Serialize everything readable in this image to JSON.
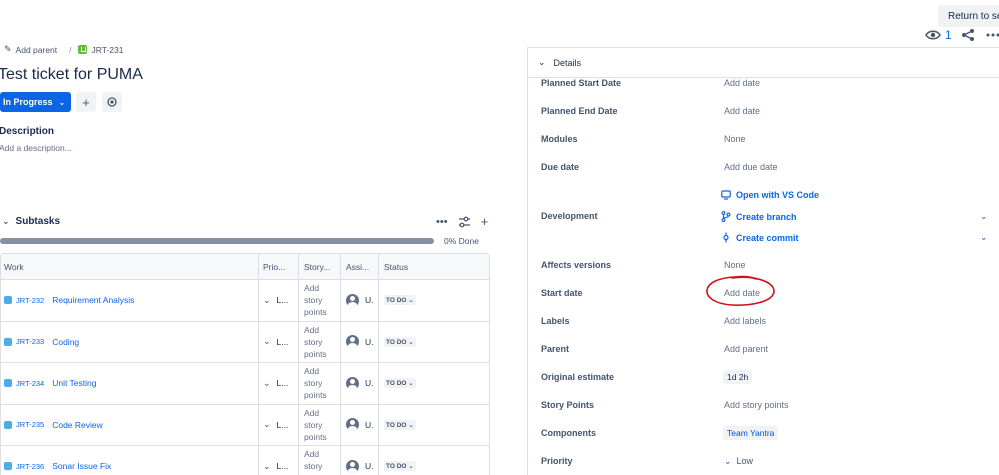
{
  "top": {
    "return_label": "Return to sea",
    "watch_count": "1"
  },
  "breadcrumb": {
    "add_parent": "Add parent",
    "separator": "/",
    "issue_key": "JRT-231"
  },
  "issue": {
    "title": "Test ticket for PUMA",
    "status": "In Progress",
    "description_heading": "Description",
    "description_placeholder": "Add a description..."
  },
  "subtasks": {
    "heading": "Subtasks",
    "progress_label": "0% Done",
    "progress_fraction": 0,
    "columns": [
      "Work",
      "Prio...",
      "Story...",
      "Assi...",
      "Status"
    ],
    "rows": [
      {
        "key": "JRT-232",
        "summary": "Requirement Analysis",
        "priority": "L...",
        "story_points": "Add story points",
        "assignee": "U.",
        "status": "TO DO"
      },
      {
        "key": "JRT-233",
        "summary": "Coding",
        "priority": "L...",
        "story_points": "Add story points",
        "assignee": "U.",
        "status": "TO DO"
      },
      {
        "key": "JRT-234",
        "summary": "Unit Testing",
        "priority": "L...",
        "story_points": "Add story points",
        "assignee": "U.",
        "status": "TO DO"
      },
      {
        "key": "JRT-235",
        "summary": "Code Review",
        "priority": "L...",
        "story_points": "Add story points",
        "assignee": "U.",
        "status": "TO DO"
      },
      {
        "key": "JRT-236",
        "summary": "Sonar Issue Fix",
        "priority": "L...",
        "story_points": "Add story points",
        "assignee": "U.",
        "status": "TO DO"
      }
    ]
  },
  "details": {
    "header": "Details",
    "planned_start_label": "Planned Start Date",
    "planned_start_value": "Add date",
    "planned_end_label": "Planned End Date",
    "planned_end_value": "Add date",
    "modules_label": "Modules",
    "modules_value": "None",
    "due_label": "Due date",
    "due_value": "Add due date",
    "development_label": "Development",
    "dev_open": "Open with VS Code",
    "dev_branch": "Create branch",
    "dev_commit": "Create commit",
    "affects_label": "Affects versions",
    "affects_value": "None",
    "start_label": "Start date",
    "start_value": "Add date",
    "labels_label": "Labels",
    "labels_value": "Add labels",
    "parent_label": "Parent",
    "parent_value": "Add parent",
    "estimate_label": "Original estimate",
    "estimate_value": "1d 2h",
    "story_points_label": "Story Points",
    "story_points_value": "Add story points",
    "components_label": "Components",
    "components_value": "Team Yantra",
    "priority_label": "Priority",
    "priority_value": "Low"
  },
  "colors": {
    "brand_blue": "#0c66e4",
    "annotation_red": "#d0101a"
  }
}
